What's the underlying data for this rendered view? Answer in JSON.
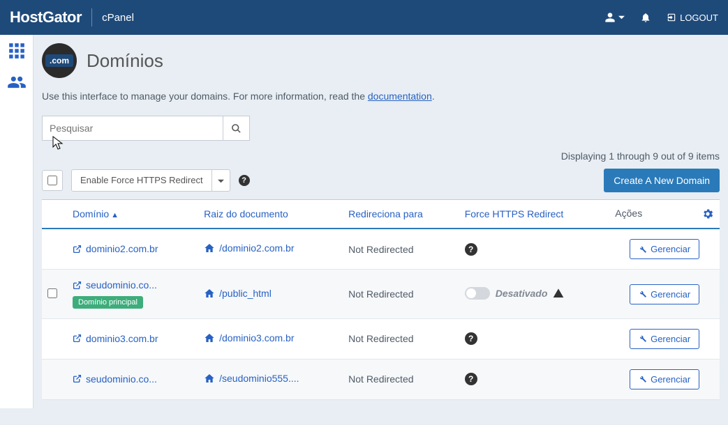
{
  "header": {
    "brand": "HostGator",
    "app": "cPanel",
    "logout": "LOGOUT"
  },
  "page": {
    "icon_text": ".com",
    "title": "Domínios",
    "intro_text": "Use this interface to manage your domains. For more information, read the ",
    "intro_link": "documentation",
    "intro_end": "."
  },
  "search": {
    "placeholder": "Pesquisar"
  },
  "status": "Displaying 1 through 9 out of 9 items",
  "toolbar": {
    "enable_https": "Enable Force HTTPS Redirect",
    "create": "Create A New Domain"
  },
  "columns": {
    "domain": "Domínio",
    "docroot": "Raiz do documento",
    "redirects": "Redireciona para",
    "force_https": "Force HTTPS Redirect",
    "actions": "Ações"
  },
  "rows": [
    {
      "domain": "dominio2.com.br",
      "docroot": "/dominio2.com.br",
      "redirect": "Not Redirected",
      "https_mode": "question",
      "main_badge": false
    },
    {
      "domain": "seudominio.co...",
      "docroot": "/public_html",
      "redirect": "Not Redirected",
      "https_mode": "disabled",
      "https_label": "Desativado",
      "main_badge": true,
      "badge_text": "Domínio principal"
    },
    {
      "domain": "dominio3.com.br",
      "docroot": "/dominio3.com.br",
      "redirect": "Not Redirected",
      "https_mode": "question",
      "main_badge": false
    },
    {
      "domain": "seudominio.co...",
      "docroot": "/seudominio555....",
      "redirect": "Not Redirected",
      "https_mode": "question",
      "main_badge": false
    }
  ],
  "manage_label": "Gerenciar"
}
